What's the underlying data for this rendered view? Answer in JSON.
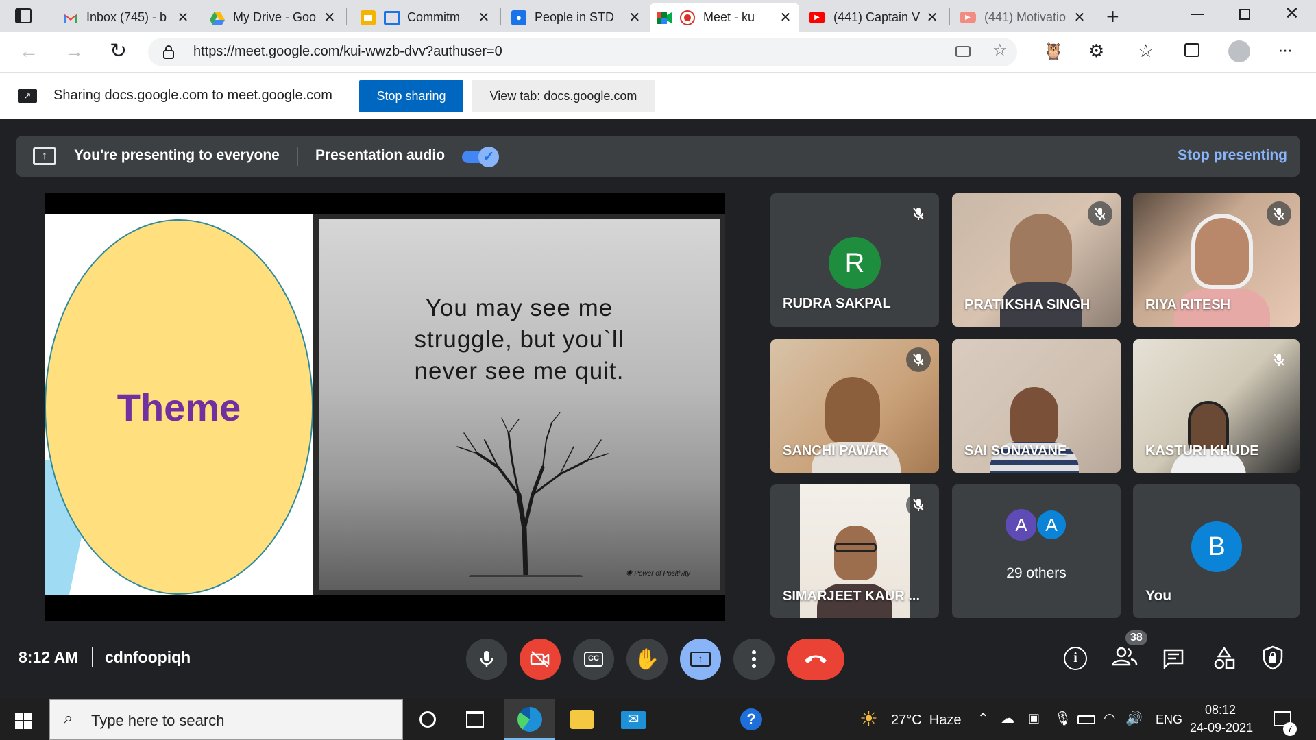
{
  "tabs": [
    {
      "title": "Inbox (745) - b",
      "icon": "gmail-icon"
    },
    {
      "title": "My Drive - Goo",
      "icon": "drive-icon"
    },
    {
      "title": "Commitm",
      "icon": "slides-icon"
    },
    {
      "title": "People in STD",
      "icon": "classroom-icon"
    },
    {
      "title": "Meet - ku",
      "icon": "meet-icon"
    },
    {
      "title": "(441) Captain V",
      "icon": "youtube-icon"
    },
    {
      "title": "(441) Motivatio",
      "icon": "youtube-icon"
    }
  ],
  "address": {
    "url": "https://meet.google.com/kui-wwzb-dvv?authuser=0"
  },
  "sharebar": {
    "message": "Sharing docs.google.com to meet.google.com",
    "stop_label": "Stop sharing",
    "view_label": "View tab: docs.google.com"
  },
  "presenting": {
    "message": "You're presenting to everyone",
    "audio_label": "Presentation audio",
    "audio_on": true,
    "stop_label": "Stop presenting"
  },
  "slide": {
    "theme_text": "Theme",
    "quote_line1": "You may see me",
    "quote_line2": "struggle, but you`ll",
    "quote_line3": "never see me quit."
  },
  "participants": [
    {
      "name": "RUDRA SAKPAL",
      "initial": "R",
      "muted": true
    },
    {
      "name": "PRATIKSHA SINGH",
      "muted": true
    },
    {
      "name": "RIYA RITESH",
      "muted": true
    },
    {
      "name": "SANCHI PAWAR",
      "muted": true
    },
    {
      "name": "SAI SONAVANE",
      "muted": false
    },
    {
      "name": "KASTURI KHUDE",
      "muted": true
    },
    {
      "name": "SIMARJEET KAUR ...",
      "muted": true
    }
  ],
  "others": {
    "initial1": "A",
    "initial2": "A",
    "label": "29 others"
  },
  "self": {
    "initial": "B",
    "label": "You"
  },
  "meeting": {
    "time": "8:12 AM",
    "code": "cdnfoopiqh",
    "people_count": "38"
  },
  "taskbar": {
    "search_placeholder": "Type here to search",
    "weather": "27°C  Haze",
    "lang": "ENG",
    "time": "08:12",
    "date": "24-09-2021",
    "notifications": "7"
  },
  "colors": {
    "accent_blue": "#1a73e8",
    "meet_bg": "#202124",
    "tile_bg": "#3c4043",
    "end_call_red": "#ea4335",
    "link_blue": "#8ab4f8"
  }
}
